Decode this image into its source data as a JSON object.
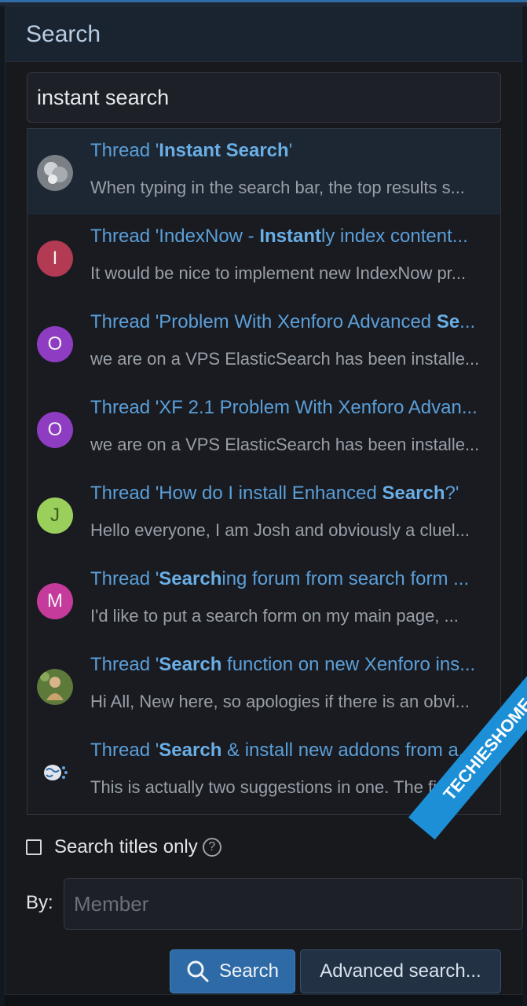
{
  "panel": {
    "title": "Search"
  },
  "search": {
    "value": "instant search"
  },
  "results": [
    {
      "avatar": "photo",
      "avatar_color": "#8a8f96",
      "title_pre": "Thread '",
      "title_bold": "Instant Search",
      "title_post": "'",
      "snippet": "When typing in the search bar, the top results s..."
    },
    {
      "avatar": "I",
      "avatar_color": "#b23a52",
      "title_pre": "Thread 'IndexNow - ",
      "title_bold": "Instant",
      "title_post": "ly index content...",
      "snippet": "It would be nice to implement new IndexNow pr..."
    },
    {
      "avatar": "O",
      "avatar_color": "#8e3cc1",
      "title_pre": "Thread 'Problem With Xenforo Advanced ",
      "title_bold": "Se",
      "title_post": "...",
      "snippet": "we are on a VPS ElasticSearch has been installe..."
    },
    {
      "avatar": "O",
      "avatar_color": "#8e3cc1",
      "title_pre": "Thread 'XF 2.1 Problem With Xenforo Advan...",
      "title_bold": "",
      "title_post": "",
      "snippet": "we are on a VPS ElasticSearch has been installe..."
    },
    {
      "avatar": "J",
      "avatar_color": "#9bcf5b",
      "title_pre": "Thread 'How do I install Enhanced ",
      "title_bold": "Search",
      "title_post": "?'",
      "snippet": "Hello everyone, I am Josh and obviously a cluel..."
    },
    {
      "avatar": "M",
      "avatar_color": "#c43b9b",
      "title_pre": "Thread '",
      "title_bold": "Search",
      "title_post": "ing forum from search form ...",
      "snippet": "I'd like to put a search form on my main page, ..."
    },
    {
      "avatar": "photo2",
      "avatar_color": "#6f8a4a",
      "title_pre": "Thread '",
      "title_bold": "Search",
      "title_post": " function on new Xenforo ins...",
      "snippet": "Hi All, New here, so apologies if there is an obvi..."
    },
    {
      "avatar": "brain",
      "avatar_color": "#dfe6ee",
      "title_pre": "Thread '",
      "title_bold": "Search",
      "title_post": " & install new addons from a...",
      "snippet": "This is actually two suggestions in one. The first..."
    }
  ],
  "options": {
    "titles_only_label": "Search titles only",
    "help_icon": "?"
  },
  "by": {
    "label": "By:",
    "placeholder": "Member"
  },
  "buttons": {
    "search_label": "Search",
    "advanced_label": "Advanced search..."
  },
  "watermark": {
    "text": "TECHIESHOME.COM"
  },
  "colors": {
    "accent": "#2e6aa6",
    "link": "#5b9fd9",
    "panel_bg": "#17191d"
  }
}
